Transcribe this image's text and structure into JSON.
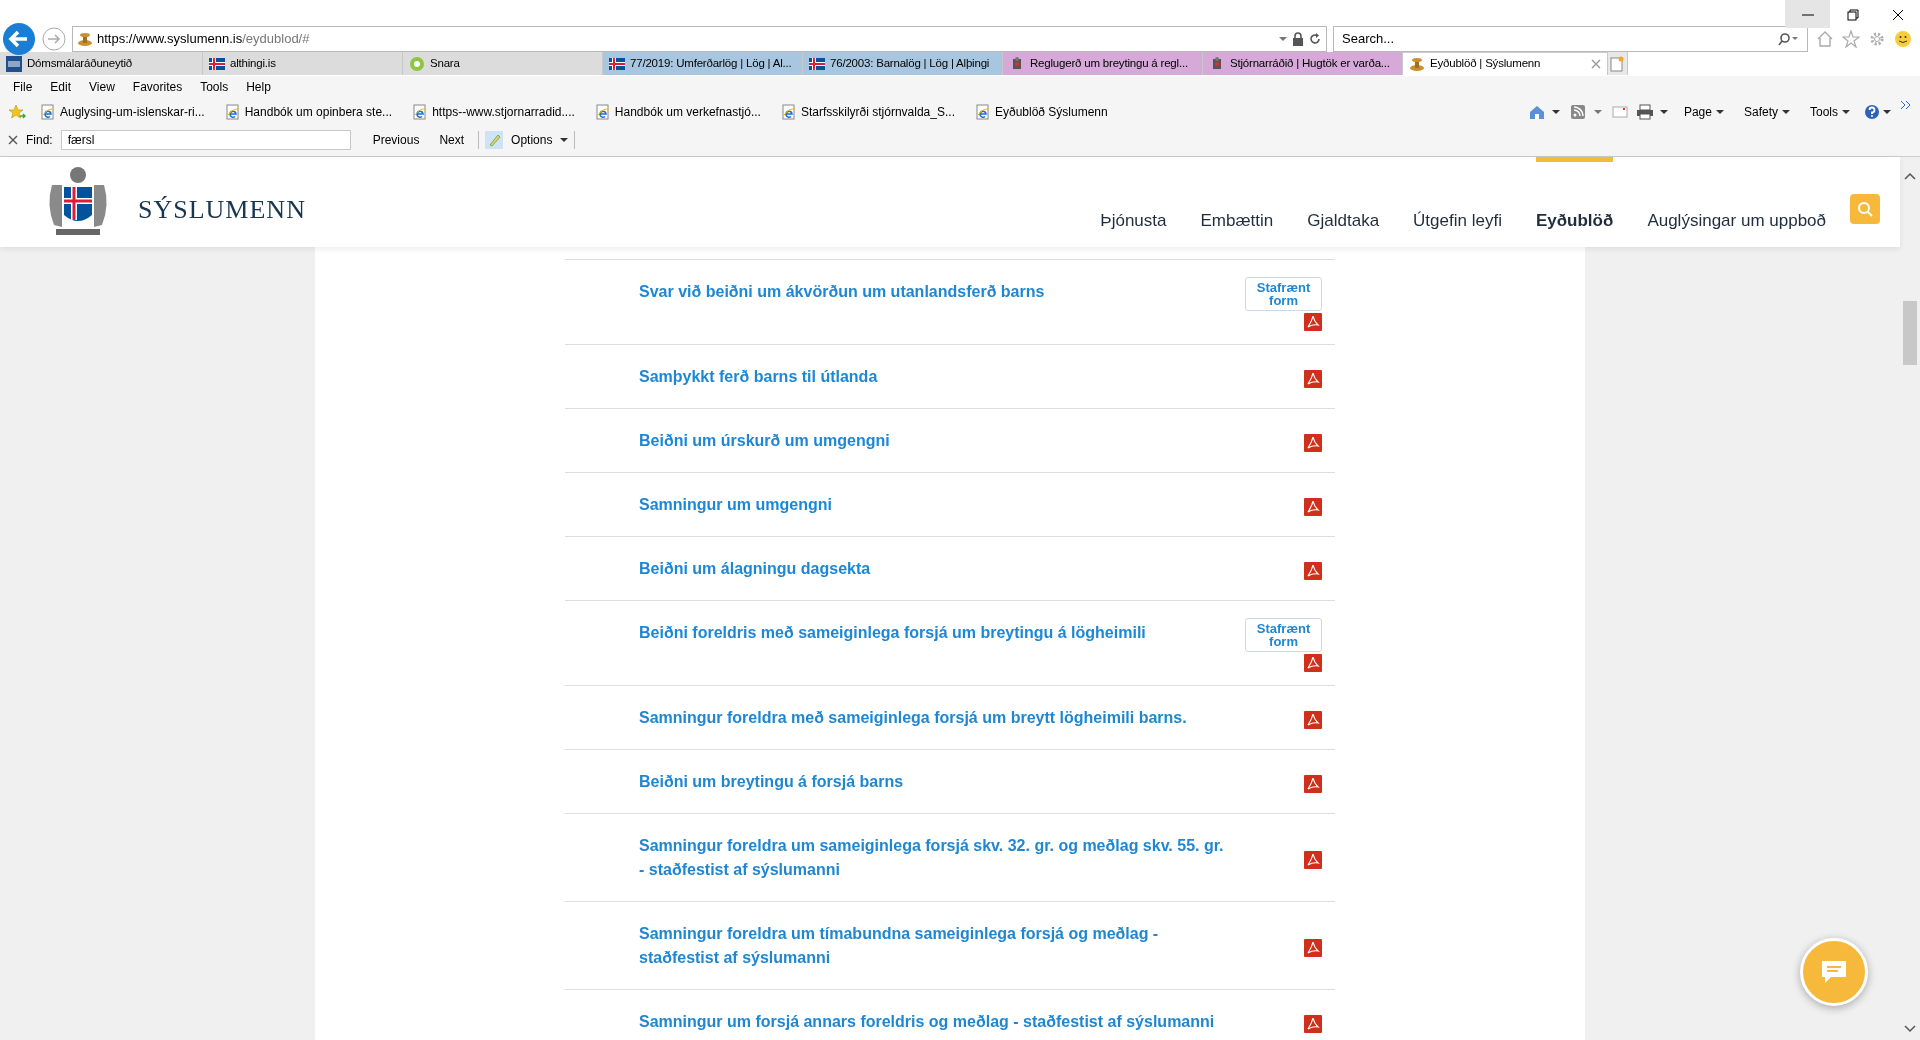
{
  "browser": {
    "url": {
      "scheme": "https://",
      "host": "www.syslumenn.is",
      "path": "/eydublod/#"
    },
    "search": {
      "placeholder": "Search..."
    },
    "tabs": [
      {
        "label": "Dómsmálaráðuneytið",
        "selected": false,
        "color": "#dcdcdc"
      },
      {
        "label": "althingi.is",
        "selected": false,
        "color": "#dcdcdc"
      },
      {
        "label": "Snara",
        "selected": false,
        "color": "#dcdcdc"
      },
      {
        "label": "77/2019: Umferðarlög | Lög | Al...",
        "selected": false,
        "color": "#a9c6e0"
      },
      {
        "label": "76/2003: Barnalög | Lög | Alþingi",
        "selected": false,
        "color": "#a9c6e0"
      },
      {
        "label": "Reglugerð um breytingu á regl...",
        "selected": false,
        "color": "#d6a9d9"
      },
      {
        "label": "Stjórnarráðið | Hugtök er varða...",
        "selected": false,
        "color": "#d6a9d9"
      },
      {
        "label": "Eyðublöð | Sýslumenn",
        "selected": true,
        "color": "#ffffff"
      }
    ],
    "menu": [
      "File",
      "Edit",
      "View",
      "Favorites",
      "Tools",
      "Help"
    ],
    "favorites": [
      "Auglysing-um-islenskar-ri...",
      "Handbók um opinbera ste...",
      "https--www.stjornarradid....",
      "Handbók um verkefnastjó...",
      "Starfsskilyrði stjórnvalda_S...",
      "Eyðublöð  Sýslumenn"
    ],
    "command_bar": [
      "Page",
      "Safety",
      "Tools"
    ],
    "find": {
      "label": "Find:",
      "value": "færsl",
      "previous": "Previous",
      "next": "Next",
      "options": "Options"
    }
  },
  "site": {
    "logo_text": "SÝSLUMENN",
    "nav": [
      {
        "label": "Þjónusta",
        "selected": false
      },
      {
        "label": "Embættin",
        "selected": false
      },
      {
        "label": "Gjaldtaka",
        "selected": false
      },
      {
        "label": "Útgefin leyfi",
        "selected": false
      },
      {
        "label": "Eyðublöð",
        "selected": true
      },
      {
        "label": "Auglýsingar um uppboð",
        "selected": false
      }
    ]
  },
  "forms": [
    {
      "title": "Svar við beiðni um ákvörðun um utanlandsferð barns",
      "digital_form": "Stafrænt form"
    },
    {
      "title": "Samþykkt ferð barns til útlanda"
    },
    {
      "title": "Beiðni um úrskurð um umgengni"
    },
    {
      "title": "Samningur um umgengni"
    },
    {
      "title": "Beiðni um álagningu dagsekta"
    },
    {
      "title": "Beiðni foreldris með sameiginlega forsjá um breytingu á lögheimili",
      "digital_form": "Stafrænt form"
    },
    {
      "title": "Samningur foreldra með sameiginlega forsjá um breytt lögheimili barns."
    },
    {
      "title": "Beiðni um breytingu á forsjá barns"
    },
    {
      "title": "Samningur foreldra um sameiginlega forsjá skv. 32. gr. og meðlag skv. 55. gr. - staðfestist af sýslumanni"
    },
    {
      "title": "Samningur foreldra um tímabundna sameiginlega forsjá og meðlag - staðfestist af sýslumanni"
    },
    {
      "title": "Samningur um forsjá annars foreldris og meðlag - staðfestist af sýslumanni"
    }
  ]
}
